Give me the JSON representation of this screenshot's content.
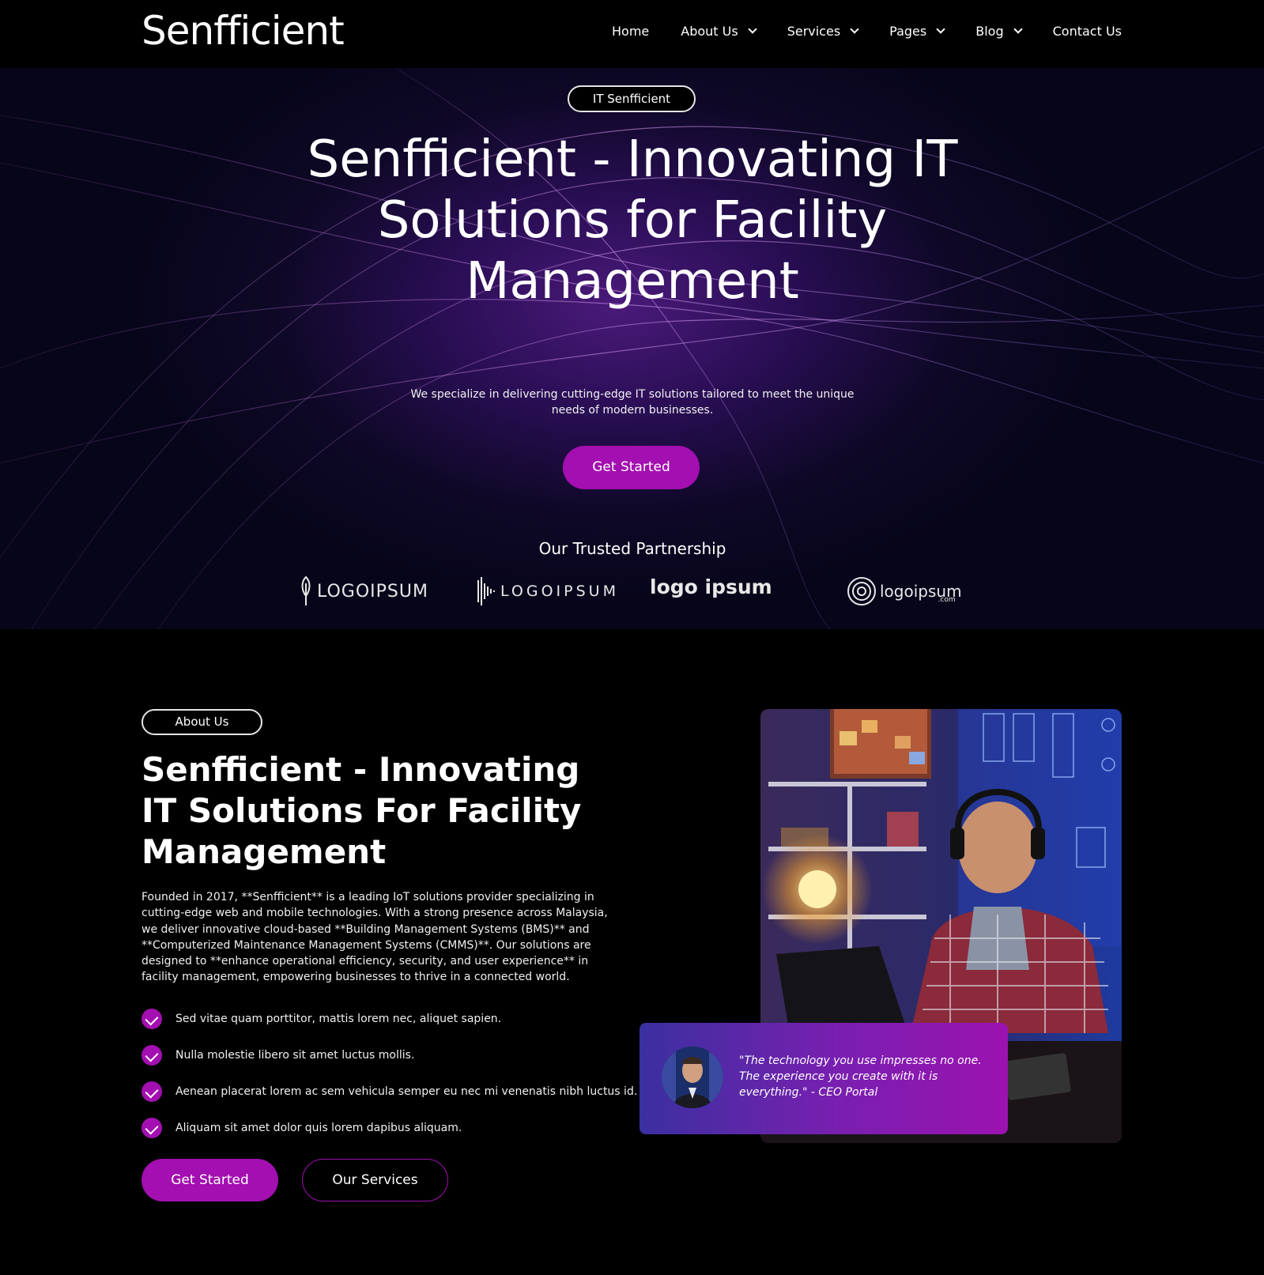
{
  "nav": {
    "brand": "Senfficient",
    "items": [
      {
        "label": "Home",
        "dropdown": false
      },
      {
        "label": "About Us",
        "dropdown": true
      },
      {
        "label": "Services",
        "dropdown": true
      },
      {
        "label": "Pages",
        "dropdown": true
      },
      {
        "label": "Blog",
        "dropdown": true
      },
      {
        "label": "Contact Us",
        "dropdown": false
      }
    ]
  },
  "hero": {
    "tag": "IT Senfficient",
    "title": "Senfficient - Innovating IT Solutions for Facility Management",
    "subtitle": "We specialize in delivering cutting-edge IT solutions tailored to meet the unique needs of modern businesses.",
    "cta": "Get Started",
    "partners_title": "Our Trusted Partnership",
    "partners": [
      "LOGOIPSUM",
      "LOGOIPSUM",
      "logo ipsum",
      "logoipsum"
    ],
    "partner_suffix": ".com"
  },
  "about": {
    "tag": "About Us",
    "title": "Senfficient - Innovating IT Solutions For Facility Management",
    "text": "Founded in 2017, **Senfficient** is a leading IoT solutions provider specializing in cutting-edge web and mobile technologies. With a strong presence across Malaysia, we deliver innovative cloud-based **Building Management Systems (BMS)** and **Computerized Maintenance Management Systems (CMMS)**. Our solutions are designed to **enhance operational efficiency, security, and user experience** in facility management, empowering businesses to thrive in a connected world.",
    "checks": [
      "Sed vitae quam porttitor, mattis lorem nec, aliquet sapien.",
      "Nulla molestie libero sit amet luctus mollis.",
      "Aenean placerat lorem ac sem vehicula semper eu nec mi venenatis nibh luctus id.",
      "Aliquam sit amet dolor quis lorem dapibus aliquam."
    ],
    "cta_primary": "Get Started",
    "cta_secondary": "Our Services",
    "quote": "\"The technology you use impresses no one. The experience you create with it is everything.\" - CEO Portal"
  },
  "colors": {
    "accent": "#a30fb0",
    "background": "#000000"
  }
}
